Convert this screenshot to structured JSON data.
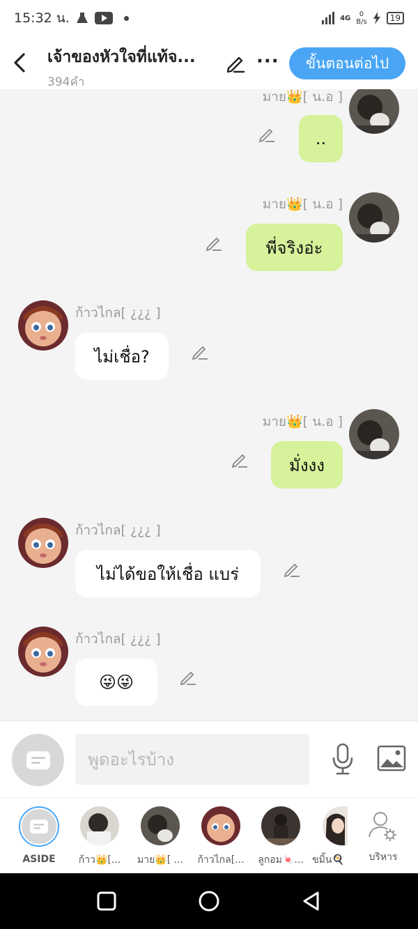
{
  "status_bar": {
    "time": "15:32 น.",
    "network": "4G",
    "speed_value": "0",
    "speed_unit": "B/s",
    "battery": "19"
  },
  "header": {
    "title": "เจ้าของหัวใจที่แท้จ...",
    "subtitle": "394คำ",
    "next_button": "ขั้นตอนต่อไป",
    "more_label": "···"
  },
  "messages": [
    {
      "sender": "มาย👑[ น.อ ]",
      "text": "..",
      "side": "right",
      "avatar": "mai"
    },
    {
      "sender": "มาย👑[ น.อ ]",
      "text": "พี่จริงอ่ะ",
      "side": "right",
      "avatar": "mai"
    },
    {
      "sender": "ก้าวไกล[ ¿¿¿ ]",
      "text": "ไม่เชื่อ?",
      "side": "left",
      "avatar": "kaew"
    },
    {
      "sender": "มาย👑[ น.อ ]",
      "text": "มั่งงง",
      "side": "right",
      "avatar": "mai"
    },
    {
      "sender": "ก้าวไกล[ ¿¿¿ ]",
      "text": "ไม่ได้ขอให้เชื่อ แบร่",
      "side": "left",
      "avatar": "kaew"
    },
    {
      "sender": "ก้าวไกล[ ¿¿¿ ]",
      "text": "😜😜",
      "side": "left",
      "avatar": "kaew"
    }
  ],
  "input": {
    "placeholder": "พูดอะไรบ้าง",
    "value": ""
  },
  "members": [
    {
      "label": "ASIDE",
      "kind": "aside"
    },
    {
      "label": "ก้าว👑[...",
      "kind": "photo-a"
    },
    {
      "label": "มาย👑[ ...",
      "kind": "mai"
    },
    {
      "label": "ก้าวไกล[...",
      "kind": "kaew"
    },
    {
      "label": "ลูกอม🍬...",
      "kind": "photo-b"
    },
    {
      "label": "ขมิ้น🍳",
      "kind": "photo-c"
    },
    {
      "label": "บริหาร",
      "kind": "manage"
    }
  ],
  "colors": {
    "accent": "#4aa6f5",
    "my_bubble": "#d6f29a",
    "their_bubble": "#ffffff",
    "chat_bg": "#f4f4f4"
  },
  "icons": [
    "back-icon",
    "pencil-icon",
    "more-icon",
    "edit-icon",
    "chat-bubble-icon",
    "mic-icon",
    "image-icon",
    "manage-user-icon",
    "nav-square-icon",
    "nav-circle-icon",
    "nav-back-icon"
  ]
}
